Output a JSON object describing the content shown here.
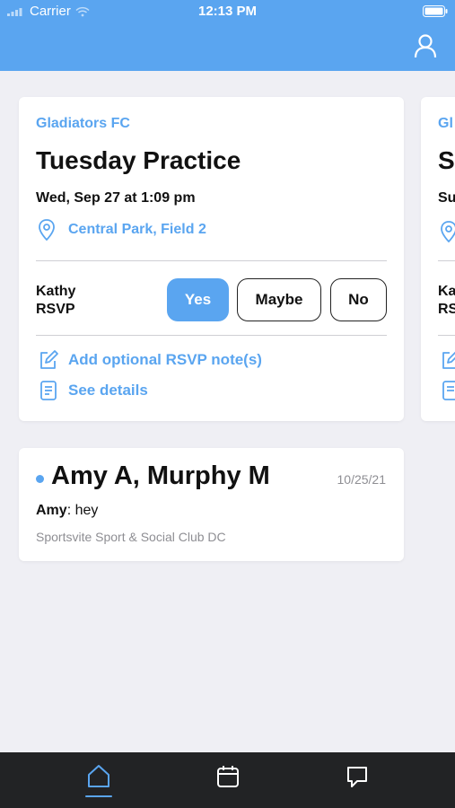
{
  "status_bar": {
    "carrier": "Carrier",
    "time": "12:13 PM"
  },
  "event": {
    "team": "Gladiators FC",
    "title": "Tuesday Practice",
    "datetime": "Wed, Sep 27 at 1:09 pm",
    "location": "Central Park, Field 2",
    "rsvp_name": "Kathy",
    "rsvp_label": "RSVP",
    "yes_label": "Yes",
    "maybe_label": "Maybe",
    "no_label": "No",
    "add_note_label": "Add optional RSVP note(s)",
    "see_details_label": "See details"
  },
  "peek_card": {
    "team_fragment": "Gl",
    "title_fragment": "S",
    "date_fragment": "Su",
    "rsvp_name_fragment": "Ka",
    "rsvp_label_fragment": "RS"
  },
  "message": {
    "title": "Amy A, Murphy M",
    "date": "10/25/21",
    "sender": "Amy",
    "separator": ":",
    "text": " hey",
    "club": "Sportsvite Sport & Social Club DC"
  },
  "colors": {
    "accent": "#5aa5f0",
    "tabbar": "#222325",
    "background": "#efeff4"
  },
  "tabs": {
    "active": "home",
    "icons": [
      "home-icon",
      "calendar-icon",
      "chat-icon"
    ]
  }
}
